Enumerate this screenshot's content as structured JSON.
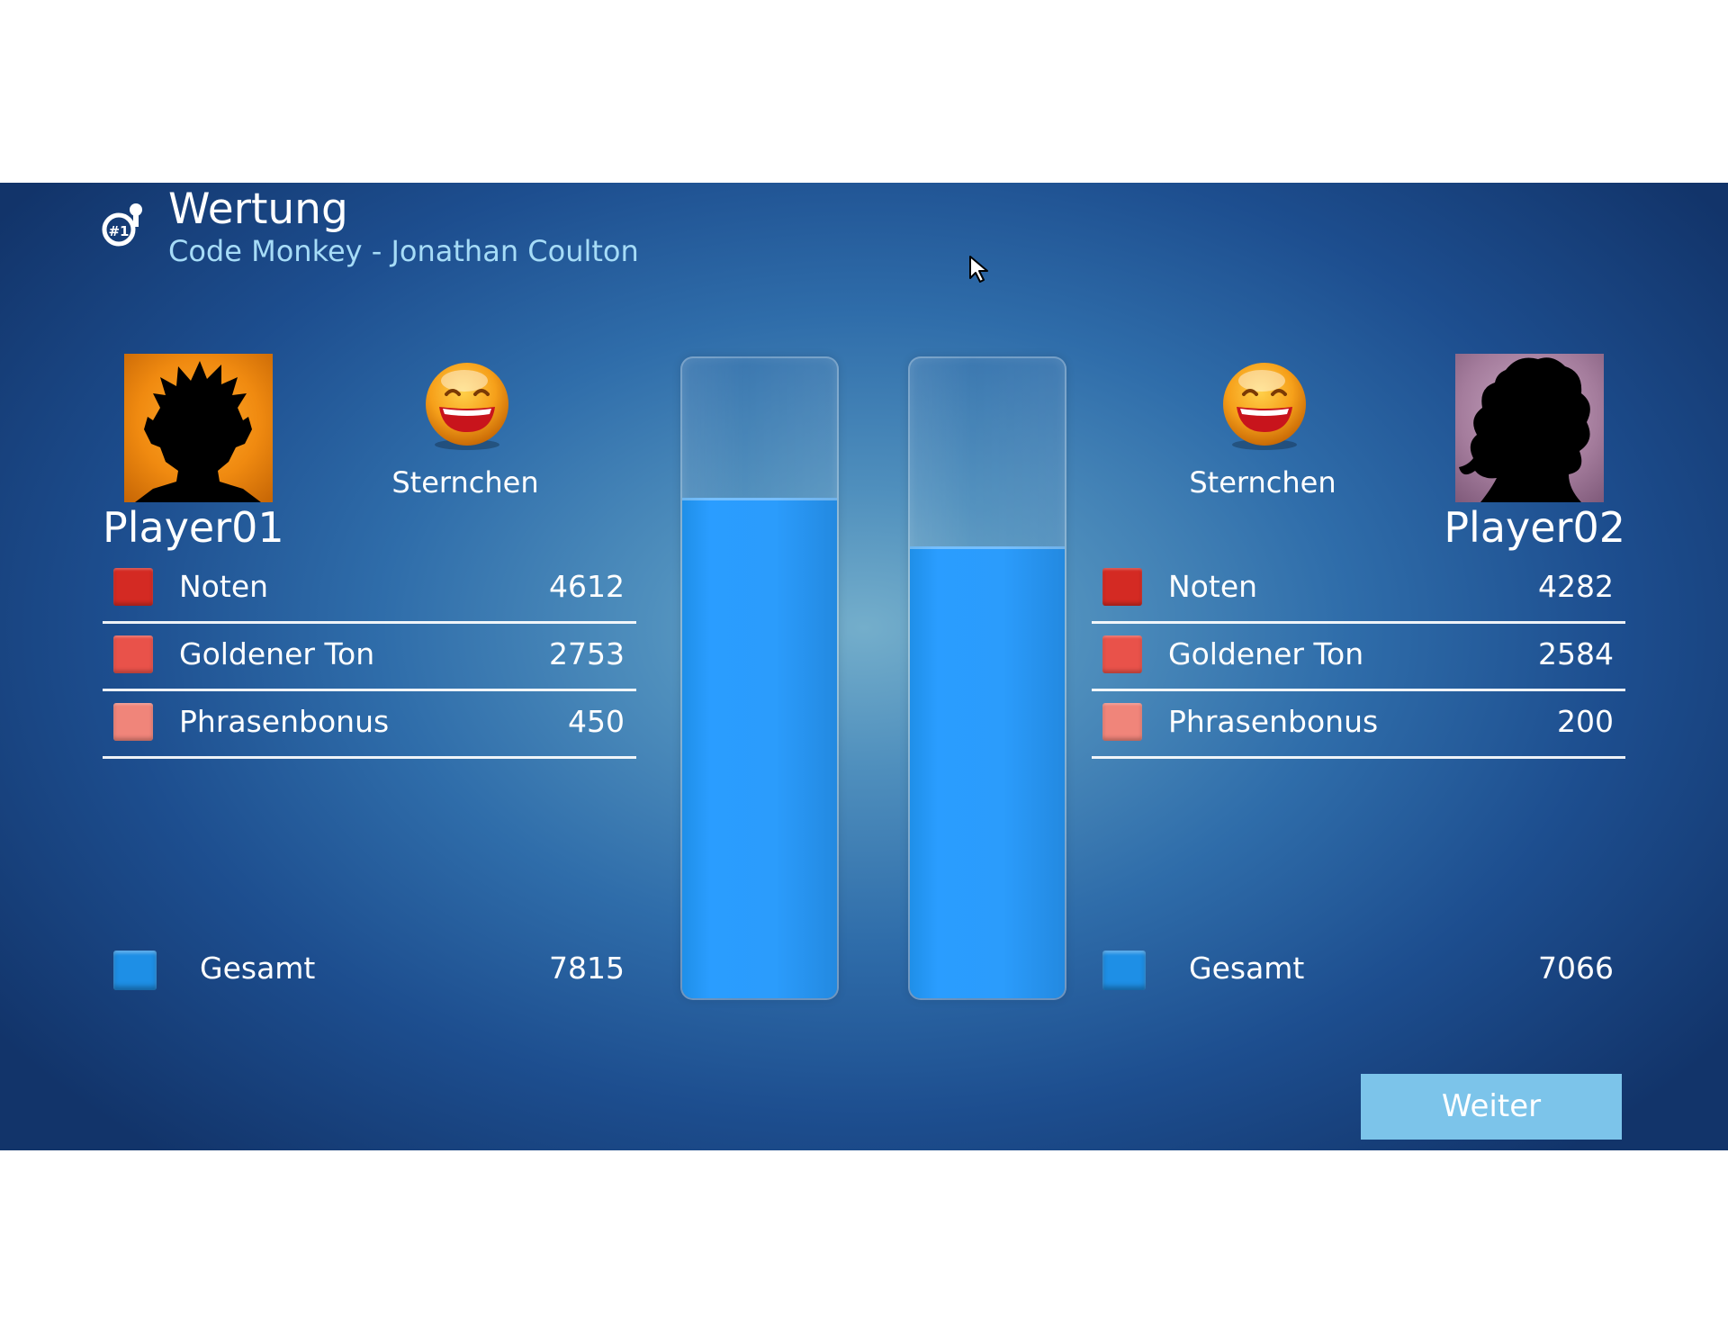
{
  "header": {
    "title": "Wertung",
    "subtitle": "Code Monkey - Jonathan Coulton",
    "logo_icon": "microphone-number-one-icon"
  },
  "colors": {
    "notes": "#d42a23",
    "golden": "#e9524a",
    "phrase": "#f0857a",
    "total": "#1e8fe6",
    "bar_fill": "#2a9dff",
    "button_bg": "#7cc4ea"
  },
  "players": [
    {
      "name": "Player01",
      "rating": {
        "label": "Sternchen",
        "icon": "grinning-smiley-icon"
      },
      "rows": [
        {
          "label": "Noten",
          "value": "4612"
        },
        {
          "label": "Goldener Ton",
          "value": "2753"
        },
        {
          "label": "Phrasenbonus",
          "value": "450"
        }
      ],
      "total": {
        "label": "Gesamt",
        "value": "7815"
      },
      "bar_level": 0.7815
    },
    {
      "name": "Player02",
      "rating": {
        "label": "Sternchen",
        "icon": "grinning-smiley-icon"
      },
      "rows": [
        {
          "label": "Noten",
          "value": "4282"
        },
        {
          "label": "Goldener Ton",
          "value": "2584"
        },
        {
          "label": "Phrasenbonus",
          "value": "200"
        }
      ],
      "total": {
        "label": "Gesamt",
        "value": "7066"
      },
      "bar_level": 0.7066
    }
  ],
  "continue_button": {
    "label": "Weiter"
  }
}
